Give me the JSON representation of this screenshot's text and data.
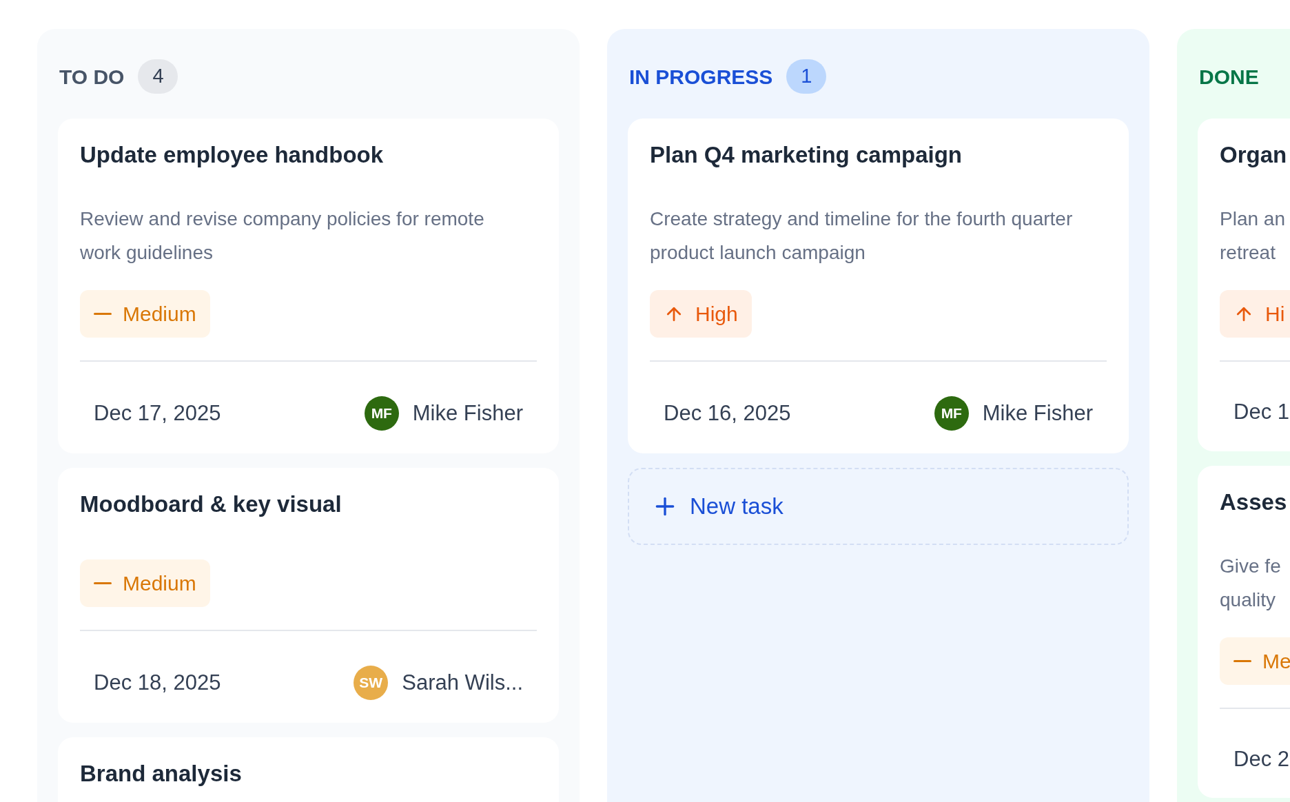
{
  "columns": [
    {
      "kind": "todo",
      "title": "TO DO",
      "count": "4",
      "cards": [
        {
          "title": "Update employee handbook",
          "description": "Review and revise company policies for remote work guidelines",
          "priority": {
            "kind": "medium",
            "label": "Medium"
          },
          "date": "Dec 17, 2025",
          "assignee": {
            "initials": "MF",
            "name": "Mike Fisher",
            "color": "#2d6a0f"
          }
        },
        {
          "title": "Moodboard & key visual",
          "priority": {
            "kind": "medium",
            "label": "Medium"
          },
          "date": "Dec 18, 2025",
          "assignee": {
            "initials": "SW",
            "name": "Sarah Wils...",
            "color": "#e8ad4a"
          }
        },
        {
          "title": "Brand analysis"
        }
      ]
    },
    {
      "kind": "progress",
      "title": "IN PROGRESS",
      "count": "1",
      "new_task": "New task",
      "cards": [
        {
          "title": "Plan Q4 marketing campaign",
          "description": "Create strategy and timeline for the fourth quarter product launch campaign",
          "priority": {
            "kind": "high",
            "label": "High"
          },
          "date": "Dec 16, 2025",
          "assignee": {
            "initials": "MF",
            "name": "Mike Fisher",
            "color": "#2d6a0f"
          }
        }
      ]
    },
    {
      "kind": "done",
      "title": "DONE",
      "cards": [
        {
          "title": "Organ",
          "description": "Plan an\nretreat",
          "priority": {
            "kind": "high",
            "label": "Hi"
          },
          "date": "Dec 1"
        },
        {
          "title": "Asses",
          "description": "Give fe\nquality",
          "priority": {
            "kind": "medium",
            "label": "Me"
          },
          "date": "Dec 2"
        }
      ]
    }
  ]
}
